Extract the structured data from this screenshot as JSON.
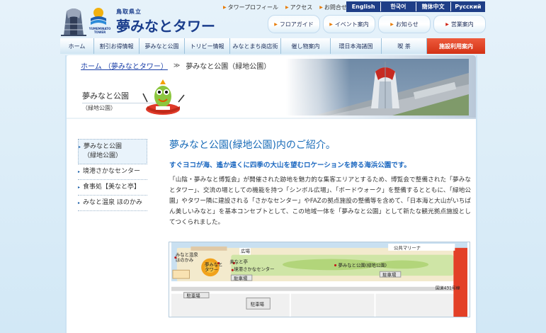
{
  "brand": {
    "prefecture": "鳥取県立",
    "name": "夢みなとタワー",
    "romaji": "YUMEMINATO TOWER"
  },
  "top_links": [
    {
      "label": "タワープロフィール"
    },
    {
      "label": "アクセス"
    },
    {
      "label": "お問合せ"
    }
  ],
  "languages": [
    "English",
    "한국어",
    "簡体中文",
    "Русский"
  ],
  "sub_nav": [
    {
      "label": "フロアガイド"
    },
    {
      "label": "イベント案内"
    },
    {
      "label": "お知らせ"
    },
    {
      "label": "営業案内"
    }
  ],
  "main_nav": [
    {
      "label": "ホーム",
      "active": false
    },
    {
      "label": "割引お得情報",
      "active": false
    },
    {
      "label": "夢みなと公園",
      "active": false
    },
    {
      "label": "トリビー情報",
      "active": false
    },
    {
      "label": "みなとまち商店街",
      "active": false
    },
    {
      "label": "催し物案内",
      "active": false
    },
    {
      "label": "環日本海諸国",
      "active": false
    },
    {
      "label": "喫 茶",
      "active": false
    },
    {
      "label": "施設利用案内",
      "active": true
    }
  ],
  "breadcrumb": {
    "home": "ホーム （夢みなとタワー）",
    "separator": "≫",
    "current": "夢みなと公園（緑地公園）"
  },
  "hero": {
    "title": "夢みなと公園",
    "subtitle": "（緑地公園）"
  },
  "sidebar": {
    "items": [
      {
        "label": "夢みなと公園\n（緑地公園）",
        "active": true
      },
      {
        "label": "境港さかなセンター",
        "active": false
      },
      {
        "label": "食事処【美なと亭】",
        "active": false
      },
      {
        "label": "みなと温泉 ほのかみ",
        "active": false
      }
    ]
  },
  "main": {
    "heading": "夢みなと公園(緑地公園)内のご紹介。",
    "lead": "すぐヨコが海、遙か遠くに四季の大山を望むロケーションを誇る海浜公園です。",
    "body": "「山陰・夢みなと博覧会」が開催された跡地を魅力的な集客エリアとするため、博覧会で整備された「夢みなとタワー」、交流の場としての機能を持つ「シンボル広場」、「ボードウォーク」を整備するとともに、「緑地公園」やタワー隣に建設される「さかなセンター」やFAZの拠点施設の整備等を含めて、「日本海と大山がいちばん美しいみなと」を基本コンセプトとして、この地域一体を「夢みなと公園」として新たな観光拠点施設としてつくられました。"
  },
  "map": {
    "labels": {
      "onsen": "みなと温泉\nほのかみ",
      "tower": "夢みなと\nタワー",
      "restaurant": "美なと亭",
      "fish_center": "境港さかなセンター",
      "square": "広場",
      "marina": "公共マリーナ",
      "park": "夢みなと公園(緑地公園)",
      "parking": "駐車場",
      "route": "国道431号線"
    }
  },
  "colors": {
    "brand_blue": "#1a3d8c",
    "accent_orange": "#e87a00",
    "active_red": "#d33215",
    "link_blue": "#1a3fa8",
    "heading_blue": "#1a6cb8"
  }
}
